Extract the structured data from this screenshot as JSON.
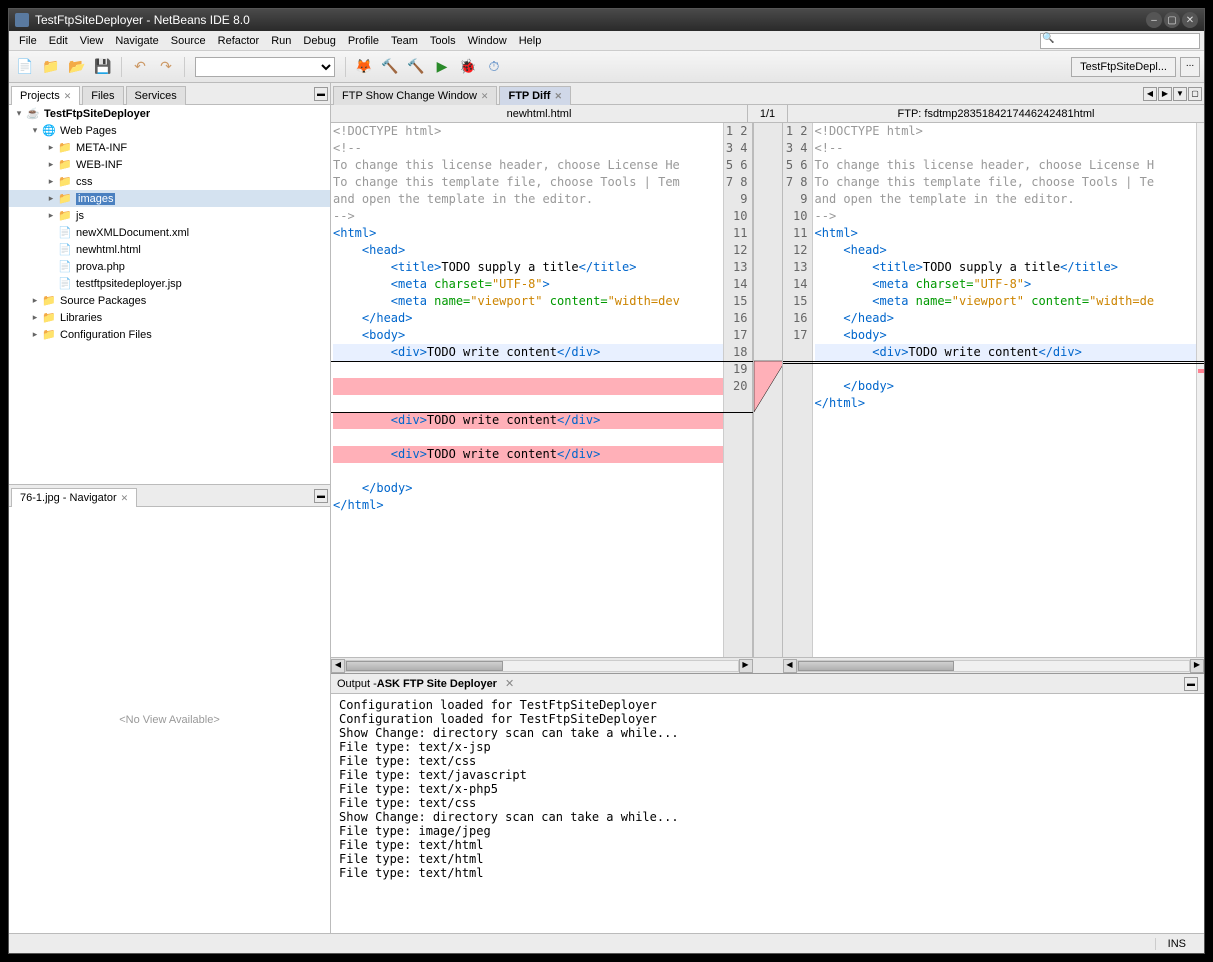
{
  "window": {
    "title": "TestFtpSiteDeployer - NetBeans IDE 8.0"
  },
  "menu": [
    "File",
    "Edit",
    "View",
    "Navigate",
    "Source",
    "Refactor",
    "Run",
    "Debug",
    "Profile",
    "Team",
    "Tools",
    "Window",
    "Help"
  ],
  "toolbar": {
    "project_label": "TestFtpSiteDepl..."
  },
  "projects": {
    "tabs": [
      {
        "label": "Projects",
        "active": true,
        "closable": true
      },
      {
        "label": "Files",
        "active": false
      },
      {
        "label": "Services",
        "active": false
      }
    ],
    "root": "TestFtpSiteDeployer",
    "nodes": [
      {
        "depth": 1,
        "label": "Web Pages",
        "expanded": true,
        "icon": "globe"
      },
      {
        "depth": 2,
        "label": "META-INF",
        "icon": "folder",
        "tw": "▸"
      },
      {
        "depth": 2,
        "label": "WEB-INF",
        "icon": "folder",
        "tw": "▸"
      },
      {
        "depth": 2,
        "label": "css",
        "icon": "folder",
        "tw": "▸"
      },
      {
        "depth": 2,
        "label": "images",
        "icon": "folder",
        "tw": "▸",
        "sel": true
      },
      {
        "depth": 2,
        "label": "js",
        "icon": "folder",
        "tw": "▸"
      },
      {
        "depth": 2,
        "label": "newXMLDocument.xml",
        "icon": "file"
      },
      {
        "depth": 2,
        "label": "newhtml.html",
        "icon": "html"
      },
      {
        "depth": 2,
        "label": "prova.php",
        "icon": "php"
      },
      {
        "depth": 2,
        "label": "testftpsitedeployer.jsp",
        "icon": "jsp"
      },
      {
        "depth": 1,
        "label": "Source Packages",
        "icon": "folder",
        "tw": "▸"
      },
      {
        "depth": 1,
        "label": "Libraries",
        "icon": "folder",
        "tw": "▸"
      },
      {
        "depth": 1,
        "label": "Configuration Files",
        "icon": "folder",
        "tw": "▸"
      }
    ]
  },
  "navigator": {
    "title": "76-1.jpg - Navigator",
    "body": "<No View Available>"
  },
  "editor": {
    "tabs": [
      {
        "label": "FTP Show Change Window",
        "active": false
      },
      {
        "label": "FTP Diff",
        "active": true
      }
    ],
    "diff": {
      "left_title": "newhtml.html",
      "counter": "1/1",
      "right_title": "FTP: fsdtmp2835184217446242481html",
      "left_lines": 20,
      "right_lines": 17
    }
  },
  "output": {
    "title_prefix": "Output - ",
    "title_bold": "ASK FTP Site Deployer",
    "lines": [
      "Configuration loaded for TestFtpSiteDeployer",
      "Configuration loaded for TestFtpSiteDeployer",
      "Show Change: directory scan can take a while...",
      "File type: text/x-jsp",
      "File type: text/css",
      "File type: text/javascript",
      "File type: text/x-php5",
      "File type: text/css",
      "Show Change: directory scan can take a while...",
      "File type: image/jpeg",
      "File type: text/html",
      "File type: text/html",
      "File type: text/html"
    ]
  },
  "status": {
    "ins": "INS"
  }
}
